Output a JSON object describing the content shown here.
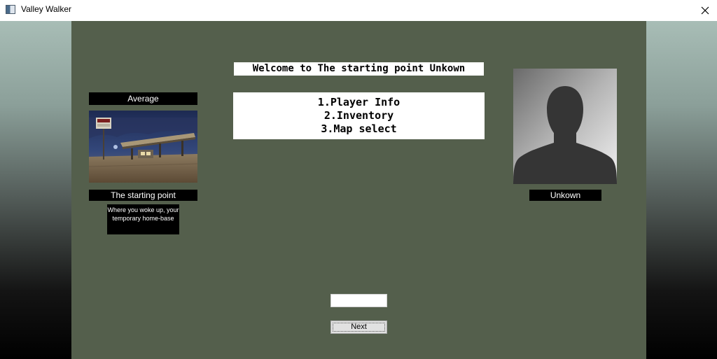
{
  "window": {
    "title": "Valley Walker",
    "close_glyph": "✕"
  },
  "main": {
    "welcome_text": "Welcome to The starting point Unkown",
    "menu_items": [
      "1.Player Info",
      "2.Inventory",
      "3.Map select"
    ]
  },
  "location": {
    "difficulty": "Average",
    "image_icon": "gas-station-image",
    "name": "The starting point",
    "description": "Where you woke up, your temporary home-base"
  },
  "player": {
    "avatar_icon": "silhouette-avatar",
    "name": "Unkown"
  },
  "input": {
    "value": "",
    "placeholder": ""
  },
  "next_button": {
    "label": "Next"
  },
  "colors": {
    "panel": "#545f4c",
    "label_bg": "#000000",
    "label_fg": "#ffffff"
  }
}
